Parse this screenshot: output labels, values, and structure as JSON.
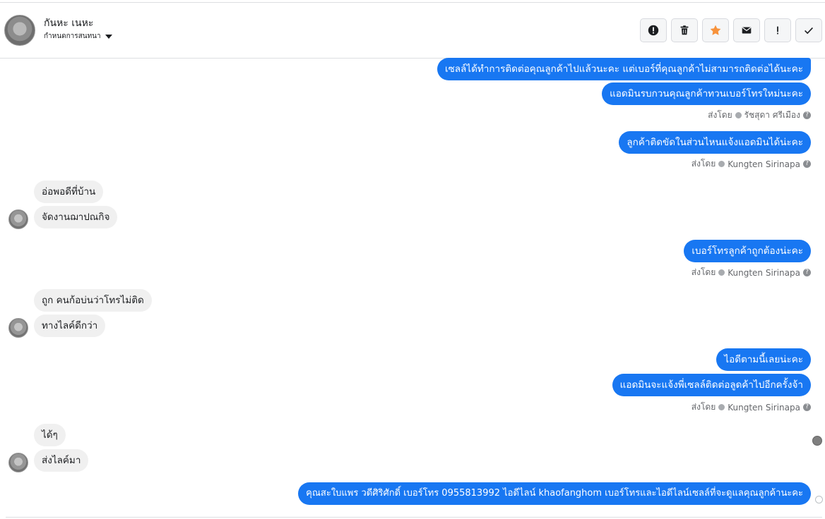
{
  "header": {
    "contact_name": "กันหะ เนหะ",
    "assignment_label": "กำหนดการสนทนา"
  },
  "toolbar": [
    {
      "name": "report-icon",
      "label": "!"
    },
    {
      "name": "trash-icon",
      "label": ""
    },
    {
      "name": "star-icon",
      "label": ""
    },
    {
      "name": "mail-icon",
      "label": ""
    },
    {
      "name": "exclamation-icon",
      "label": "!"
    },
    {
      "name": "checkmark-icon",
      "label": "✓"
    }
  ],
  "colors": {
    "outgoing_bubble": "#1877f2",
    "incoming_bubble": "#f0f0f0",
    "star": "#f7923b"
  },
  "messages": {
    "m1": "เซลล์ได้ทำการติดต่อคุณลูกค้าไปแล้วนะคะ แต่เบอร์ที่คุณลูกค้าไม่สามารถติดต่อได้นะคะ",
    "m2": "แอดมินรบกวนคุณลูกค้าทวนเบอร์โทรใหม่นะคะ",
    "m3": "ลูกค้าติดขัดในส่วนไหนแจ้งแอดมินได้น่ะคะ",
    "m4": "อ่อพอดีที่บ้าน",
    "m5": "จัดงานฌาปณกิจ",
    "m6": "เบอร์โทรลูกค้าถูกต้องน่ะคะ",
    "m7": "ถูก คนก้อบ่นว่าโทรไม่ติด",
    "m8": "ทางไลค์ดีกว่า",
    "m9": "ไอดีตามนี้เลยน่ะคะ",
    "m10": "แอดมินจะแจ้งพี่เซลล์ติดต่อลูดค้าไปอีกครั้งจ้า",
    "m11": "ได้ๆ",
    "m12": "ส่งไลค์มา",
    "m13": "คุณสะใบแพร วดีศิริศักดิ์ เบอร์โทร 0955813992 ไอดีไลน์  khaofanghom  เบอร์โทรและไอดีไลน์เซลล์ที่จะดูแลคุณลูกค้านะคะ"
  },
  "sent_by": {
    "prefix": "ส่งโดย",
    "sender1": "รัชสุดา ศรีเมือง",
    "sender2": "Kungten Sirinapa",
    "sender3": "Kungten Sirinapa",
    "sender4": "Kungten Sirinapa"
  }
}
